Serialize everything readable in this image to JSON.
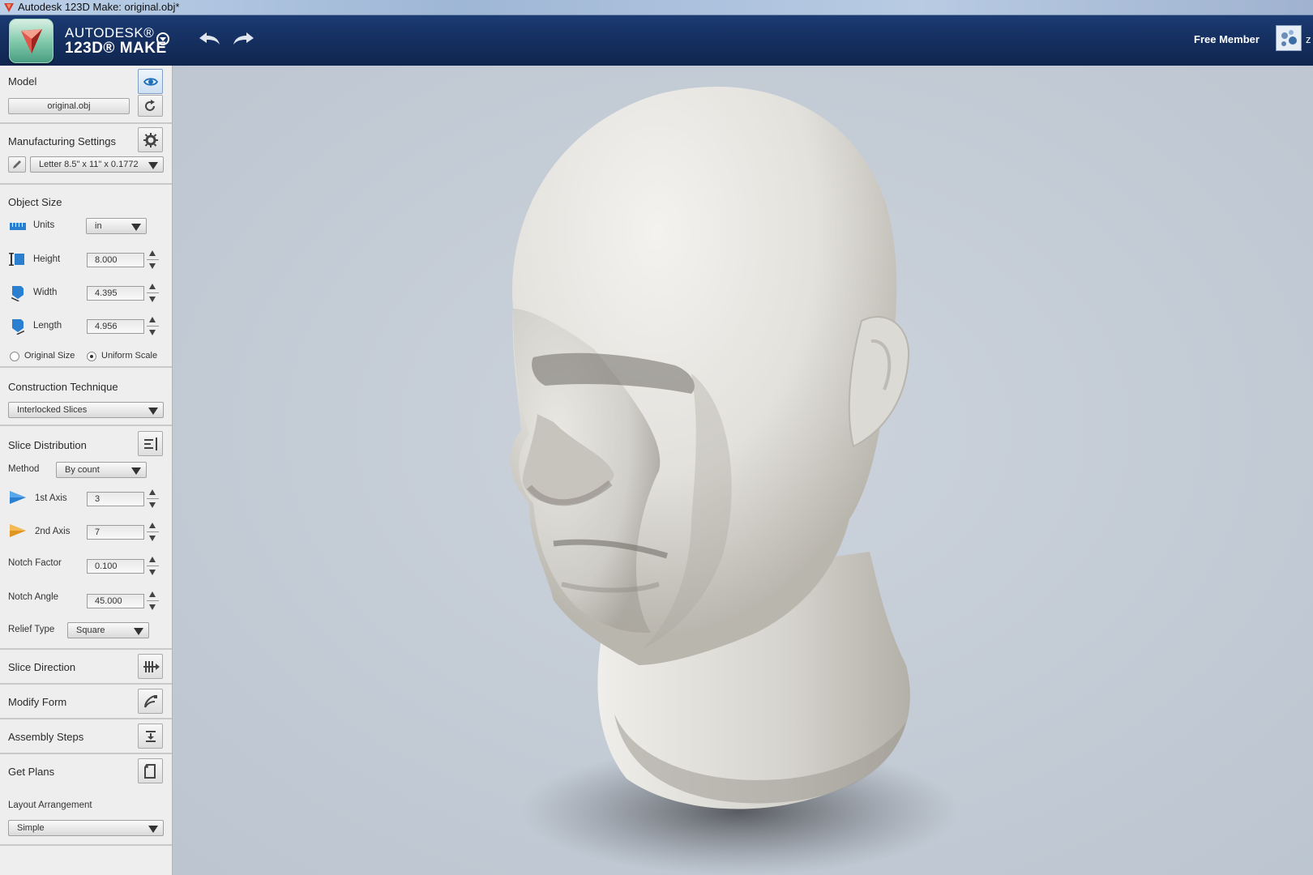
{
  "window": {
    "title": "Autodesk 123D Make: original.obj*"
  },
  "header": {
    "brand_line1": "AUTODESK®",
    "brand_line2": "123D® MAKE",
    "membership": "Free Member",
    "user_initial": "z"
  },
  "model": {
    "title": "Model",
    "file_button": "original.obj"
  },
  "manufacturing": {
    "title": "Manufacturing Settings",
    "sheet_selected": "Letter 8.5\" x 11\" x 0.1772"
  },
  "object_size": {
    "title": "Object Size",
    "units_label": "Units",
    "units_selected": "in",
    "height_label": "Height",
    "height_value": "8.000",
    "width_label": "Width",
    "width_value": "4.395",
    "length_label": "Length",
    "length_value": "4.956",
    "original_size_label": "Original Size",
    "uniform_scale_label": "Uniform Scale",
    "selected_mode": "Uniform Scale"
  },
  "construction": {
    "title": "Construction Technique",
    "selected": "Interlocked Slices"
  },
  "slice_distribution": {
    "title": "Slice Distribution",
    "method_label": "Method",
    "method_selected": "By count",
    "axis1_label": "1st Axis",
    "axis1_value": "3",
    "axis2_label": "2nd Axis",
    "axis2_value": "7",
    "notch_factor_label": "Notch Factor",
    "notch_factor_value": "0.100",
    "notch_angle_label": "Notch Angle",
    "notch_angle_value": "45.000",
    "relief_label": "Relief Type",
    "relief_selected": "Square"
  },
  "slice_direction": {
    "title": "Slice Direction"
  },
  "modify_form": {
    "title": "Modify Form"
  },
  "assembly_steps": {
    "title": "Assembly Steps"
  },
  "get_plans": {
    "title": "Get Plans",
    "layout_label": "Layout Arrangement",
    "layout_selected": "Simple"
  },
  "colors": {
    "app_bar": "#142e5e",
    "sidebar": "#eeeeee",
    "viewport": "#c4ccd6",
    "axis1": "#2a7fd0",
    "axis2": "#e0961e"
  }
}
